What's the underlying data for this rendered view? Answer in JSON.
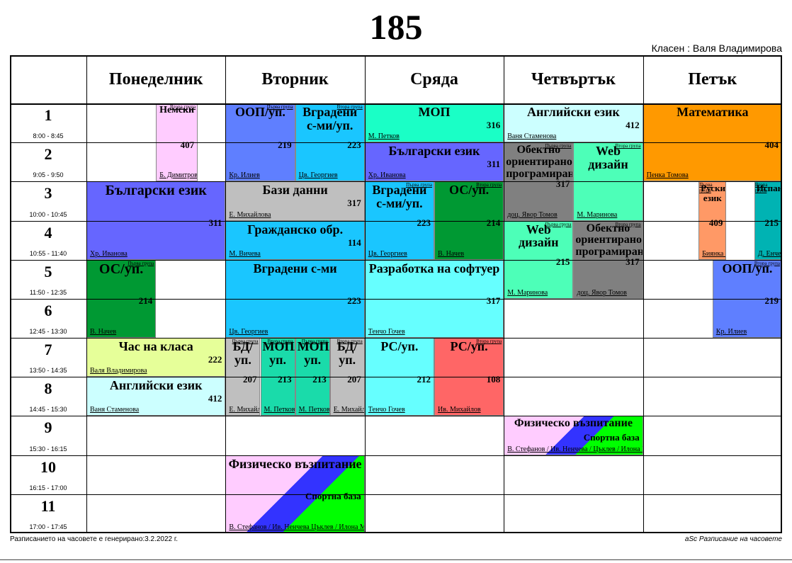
{
  "title": "185",
  "class_teacher": "Класен : Валя Владимирова",
  "days": [
    "Понеделник",
    "Вторник",
    "Сряда",
    "Четвъртък",
    "Петък"
  ],
  "periods": [
    {
      "num": "1",
      "time": "8:00 - 8:45"
    },
    {
      "num": "2",
      "time": "9:05 - 9:50"
    },
    {
      "num": "3",
      "time": "10:00 - 10:45"
    },
    {
      "num": "4",
      "time": "10:55 - 11:40"
    },
    {
      "num": "5",
      "time": "11:50 - 12:35"
    },
    {
      "num": "6",
      "time": "12:45 - 13:30"
    },
    {
      "num": "7",
      "time": "13:50 - 14:35"
    },
    {
      "num": "8",
      "time": "14:45 - 15:30"
    },
    {
      "num": "9",
      "time": "15:30 - 16:15"
    },
    {
      "num": "10",
      "time": "16:15 - 17:00"
    },
    {
      "num": "11",
      "time": "17:00 - 17:45"
    }
  ],
  "cards": [
    {
      "day": 0,
      "p": 0,
      "n": 2,
      "part": [
        0.5,
        0.8
      ],
      "subject": "Немски",
      "room": "407",
      "teacher": "Б. Димитрова",
      "group": "Втора група",
      "color": "#ffccff",
      "fs": 14
    },
    {
      "day": 0,
      "p": 2,
      "n": 2,
      "part": [
        0,
        1
      ],
      "subject": "Български език",
      "room": "311",
      "teacher": "Хр. Иванова",
      "group": "",
      "color": "#6666ff",
      "fs": 20
    },
    {
      "day": 0,
      "p": 4,
      "n": 2,
      "part": [
        0,
        0.5
      ],
      "subject": "ОС/уп.",
      "room": "214",
      "teacher": "В. Начев",
      "group": "Първа група",
      "color": "#009933",
      "fs": 20
    },
    {
      "day": 0,
      "p": 6,
      "n": 1,
      "part": [
        0,
        1
      ],
      "subject": "Час на класа",
      "room": "222",
      "teacher": "Валя Владимирова",
      "group": "",
      "color": "#e6ff99",
      "fs": 18
    },
    {
      "day": 0,
      "p": 7,
      "n": 1,
      "part": [
        0,
        1
      ],
      "subject": "Английски език",
      "room": "412",
      "teacher": "Ваня Стаменова",
      "group": "",
      "color": "#ccffff",
      "fs": 18
    },
    {
      "day": 1,
      "p": 0,
      "n": 2,
      "part": [
        0,
        0.5
      ],
      "subject": "ООП/уп.",
      "room": "219",
      "teacher": "Кр. Илиев",
      "group": "Първа група",
      "color": "#5f7fff",
      "fs": 18
    },
    {
      "day": 1,
      "p": 0,
      "n": 2,
      "part": [
        0.5,
        1
      ],
      "subject": "Вградени с-ми/уп.",
      "room": "223",
      "teacher": "Цв. Георгиев",
      "group": "Втора група",
      "color": "#1ac6ff",
      "fs": 18
    },
    {
      "day": 1,
      "p": 2,
      "n": 1,
      "part": [
        0,
        1
      ],
      "subject": "Бази данни",
      "room": "317",
      "teacher": "Е. Михайлова",
      "group": "",
      "color": "#bfbfbf",
      "fs": 18
    },
    {
      "day": 1,
      "p": 3,
      "n": 1,
      "part": [
        0,
        1
      ],
      "subject": "Гражданско обр.",
      "room": "114",
      "teacher": "М. Вичева",
      "group": "",
      "color": "#1ac6ff",
      "fs": 18
    },
    {
      "day": 1,
      "p": 4,
      "n": 2,
      "part": [
        0,
        1
      ],
      "subject": "Вградени с-ми",
      "room": "223",
      "teacher": "Цв. Георгиев",
      "group": "",
      "color": "#1ac6ff",
      "fs": 18
    },
    {
      "day": 1,
      "p": 6,
      "n": 2,
      "part": [
        0,
        0.25
      ],
      "subject": "БД/уп.",
      "room": "207",
      "teacher": "Е. Михайлова",
      "group": "Първа група",
      "color": "#bfbfbf",
      "fs": 18
    },
    {
      "day": 1,
      "p": 6,
      "n": 2,
      "part": [
        0.25,
        0.5
      ],
      "subject": "МОП/уп.",
      "room": "213",
      "teacher": "М. Петков",
      "group": "Втора група",
      "color": "#1adbaa",
      "fs": 18
    },
    {
      "day": 1,
      "p": 6,
      "n": 2,
      "part": [
        0.5,
        0.75
      ],
      "subject": "МОП/уп.",
      "room": "213",
      "teacher": "М. Петков",
      "group": "Първа група",
      "color": "#1adbaa",
      "fs": 18
    },
    {
      "day": 1,
      "p": 6,
      "n": 2,
      "part": [
        0.75,
        1
      ],
      "subject": "БД/уп.",
      "room": "207",
      "teacher": "Е. Михайлова",
      "group": "Втора група",
      "color": "#bfbfbf",
      "fs": 18
    },
    {
      "day": 1,
      "p": 9,
      "n": 2,
      "part": [
        0,
        1
      ],
      "subject": "Физическо възпитание",
      "room": "Спортна база",
      "teacher": "В. Стефанов / Ив. Ненчева Цъклев / Илона М.",
      "group": "",
      "color": "stripes",
      "fs": 18
    },
    {
      "day": 2,
      "p": 0,
      "n": 1,
      "part": [
        0,
        1
      ],
      "subject": "МОП",
      "room": "316",
      "teacher": "М. Петков",
      "group": "",
      "color": "#1affc6",
      "fs": 18
    },
    {
      "day": 2,
      "p": 1,
      "n": 1,
      "part": [
        0,
        1
      ],
      "subject": "Български език",
      "room": "311",
      "teacher": "Хр. Иванова",
      "group": "",
      "color": "#6666ff",
      "fs": 18
    },
    {
      "day": 2,
      "p": 2,
      "n": 2,
      "part": [
        0,
        0.5
      ],
      "subject": "Вградени с-ми/уп.",
      "room": "223",
      "teacher": "Цв. Георгиев",
      "group": "Първа група",
      "color": "#1ac6ff",
      "fs": 18
    },
    {
      "day": 2,
      "p": 2,
      "n": 2,
      "part": [
        0.5,
        1
      ],
      "subject": "ОС/уп.",
      "room": "214",
      "teacher": "В. Начев",
      "group": "Втора група",
      "color": "#009933",
      "fs": 18
    },
    {
      "day": 2,
      "p": 4,
      "n": 2,
      "part": [
        0,
        1
      ],
      "subject": "Разработка на софтуер",
      "room": "317",
      "teacher": "Тенчо Гочев",
      "group": "",
      "color": "#66ffff",
      "fs": 18
    },
    {
      "day": 2,
      "p": 6,
      "n": 2,
      "part": [
        0,
        0.5
      ],
      "subject": "РС/уп.",
      "room": "212",
      "teacher": "Тенчо Гочев",
      "group": "",
      "color": "#66ffff",
      "fs": 18
    },
    {
      "day": 2,
      "p": 6,
      "n": 2,
      "part": [
        0.5,
        1
      ],
      "subject": "РС/уп.",
      "room": "108",
      "teacher": "Ив. Михайлов",
      "group": "Втора група",
      "color": "#ff6666",
      "fs": 18
    },
    {
      "day": 3,
      "p": 0,
      "n": 1,
      "part": [
        0,
        1
      ],
      "subject": "Английски език",
      "room": "412",
      "teacher": "Ваня Стаменова",
      "group": "",
      "color": "#ccffff",
      "fs": 18
    },
    {
      "day": 3,
      "p": 1,
      "n": 2,
      "part": [
        0,
        0.5
      ],
      "subject": "Обектно ориентирано програмиране",
      "room": "317",
      "teacher": "доц. Явор Томов",
      "group": "Първа група",
      "color": "#808080",
      "fs": 16
    },
    {
      "day": 3,
      "p": 1,
      "n": 2,
      "part": [
        0.5,
        1
      ],
      "subject": "Web дизайн",
      "room": "",
      "teacher": "М. Маринова",
      "group": "Втора група",
      "color": "#4dffb8",
      "fs": 18
    },
    {
      "day": 3,
      "p": 3,
      "n": 2,
      "part": [
        0,
        0.5
      ],
      "subject": "Web дизайн",
      "room": "215",
      "teacher": "М. Маринова",
      "group": "Първа група",
      "color": "#4dffb8",
      "fs": 18
    },
    {
      "day": 3,
      "p": 3,
      "n": 2,
      "part": [
        0.5,
        1
      ],
      "subject": "Обектно ориентирано програмиране",
      "room": "317",
      "teacher": "доц. Явор Томов",
      "group": "Втора група",
      "color": "#808080",
      "fs": 16
    },
    {
      "day": 3,
      "p": 8,
      "n": 1,
      "part": [
        0,
        1
      ],
      "subject": "Физическо възпитание",
      "room": "Спортна база",
      "teacher": "В. Стефанов / Ив. Ненчева / Цъклев / Илона М.",
      "group": "",
      "color": "stripes",
      "fs": 16
    },
    {
      "day": 4,
      "p": 0,
      "n": 2,
      "part": [
        0,
        1
      ],
      "subject": "Математика",
      "room": "404",
      "teacher": "Пенка Томова",
      "group": "",
      "color": "#ff9900",
      "fs": 18
    },
    {
      "day": 4,
      "p": 2,
      "n": 2,
      "part": [
        0.4,
        0.6
      ],
      "subject": "Руски език",
      "room": "409",
      "teacher": "Биянка Борисова",
      "group": "Първа група",
      "color": "#ff9966",
      "fs": 13
    },
    {
      "day": 4,
      "p": 2,
      "n": 2,
      "part": [
        0.8,
        1
      ],
      "subject": "Испански",
      "room": "215",
      "teacher": "Д. Енчева",
      "group": "Втора група",
      "color": "#00b3b3",
      "fs": 13
    },
    {
      "day": 4,
      "p": 4,
      "n": 2,
      "part": [
        0.5,
        1
      ],
      "subject": "ООП/уп.",
      "room": "219",
      "teacher": "Кр. Илиев",
      "group": "Втора група",
      "color": "#5f7fff",
      "fs": 18
    }
  ],
  "footer_left": "Разписанието на часовете е генерирано:3.2.2022 г.",
  "footer_right": "aSc Разписание на часовете"
}
